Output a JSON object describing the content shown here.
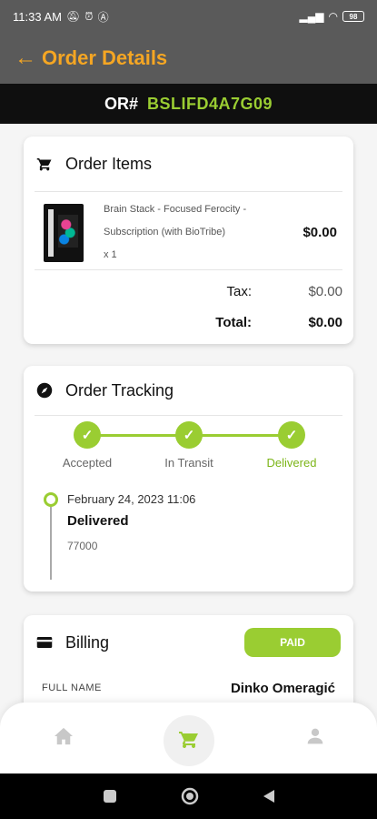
{
  "status_bar": {
    "time": "11:33 AM",
    "battery": "98"
  },
  "header": {
    "title": "Order Details"
  },
  "order": {
    "label": "OR#",
    "number": "BSLIFD4A7G09"
  },
  "order_items": {
    "title": "Order Items",
    "items": [
      {
        "name_line1": "Brain Stack - Focused Ferocity -",
        "name_line2": "Subscription (with BioTribe)",
        "quantity": "x 1",
        "price": "$0.00"
      }
    ],
    "tax_label": "Tax:",
    "tax_value": "$0.00",
    "total_label": "Total:",
    "total_value": "$0.00"
  },
  "order_tracking": {
    "title": "Order Tracking",
    "steps": [
      {
        "label": "Accepted"
      },
      {
        "label": "In Transit"
      },
      {
        "label": "Delivered"
      }
    ],
    "event": {
      "date": "February 24, 2023 11:06",
      "status": "Delivered",
      "code": "77000"
    }
  },
  "billing": {
    "title": "Billing",
    "badge": "PAID",
    "full_name_label": "FULL NAME",
    "full_name_value": "Dinko Omeragić"
  },
  "colors": {
    "accent": "#f5a623",
    "success": "#9acd32",
    "header_bg": "#5a5a5a"
  },
  "icons": [
    "back-arrow-icon",
    "cart-icon",
    "compass-icon",
    "credit-card-icon",
    "check-icon",
    "home-icon",
    "user-icon"
  ]
}
